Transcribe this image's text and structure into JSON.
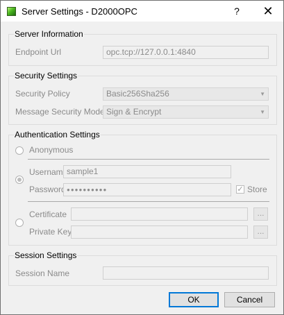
{
  "window": {
    "title": "Server Settings - D2000OPC",
    "help_icon": "?",
    "close_icon": "✕"
  },
  "server_info": {
    "title": "Server Information",
    "endpoint_label": "Endpoint Url",
    "endpoint_value": "opc.tcp://127.0.0.1:4840"
  },
  "security": {
    "title": "Security Settings",
    "policy_label": "Security Policy",
    "policy_value": "Basic256Sha256",
    "mode_label": "Message Security Mode",
    "mode_value": "Sign & Encrypt"
  },
  "auth": {
    "title": "Authentication Settings",
    "anonymous_label": "Anonymous",
    "username_label": "Username",
    "username_value": "sample1",
    "password_label": "Password",
    "password_value": "●●●●●●●●●●",
    "store_label": "Store",
    "store_checked": true,
    "certificate_label": "Certificate",
    "certificate_value": "",
    "private_key_label": "Private Key",
    "private_key_value": "",
    "browse_label": "..."
  },
  "session": {
    "title": "Session Settings",
    "name_label": "Session Name",
    "name_value": ""
  },
  "buttons": {
    "ok": "OK",
    "cancel": "Cancel"
  }
}
